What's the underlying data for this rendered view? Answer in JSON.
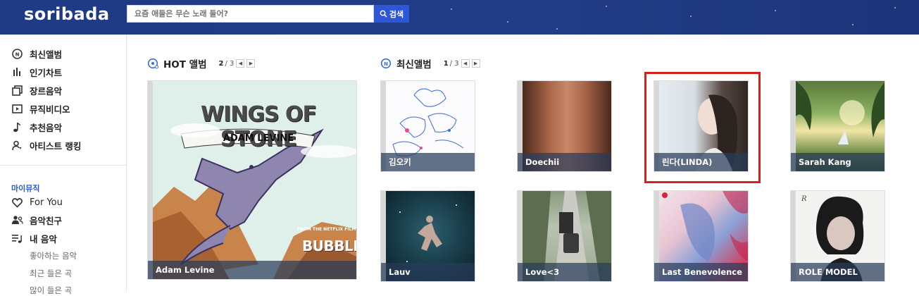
{
  "header": {
    "logo": "soribada",
    "search_placeholder": "요즘 애들은 무슨 노래 들어?",
    "search_button": "검색"
  },
  "sidebar": {
    "main_items": [
      {
        "label": "최신앨범",
        "icon": "new-album-icon"
      },
      {
        "label": "인기차트",
        "icon": "chart-bars-icon"
      },
      {
        "label": "장르음악",
        "icon": "genre-squares-icon"
      },
      {
        "label": "뮤직비디오",
        "icon": "video-play-icon"
      },
      {
        "label": "추천음악",
        "icon": "music-note-icon"
      },
      {
        "label": "아티스트 랭킹",
        "icon": "artist-person-icon"
      }
    ],
    "mymusic_label": "마이뮤직",
    "mymusic_items": [
      {
        "label": "For You",
        "icon": "heart-icon"
      },
      {
        "label": "음악친구",
        "icon": "friends-icon"
      },
      {
        "label": "내 음악",
        "icon": "my-music-list-icon"
      }
    ],
    "sub_items": [
      "좋아하는 음악",
      "최근 들은 곡",
      "많이 들은 곡"
    ]
  },
  "hot_album": {
    "title": "HOT 앨범",
    "page_current": "2",
    "page_total": "/ 3",
    "album": {
      "caption": "Adam Levine",
      "art_title": "WINGS OF STONE",
      "art_artist": "ADAM LEVINE",
      "art_netflix": "FROM THE NETFLIX FILM",
      "art_film": "BUBBLE"
    }
  },
  "new_album": {
    "title": "최신앨범",
    "page_current": "1",
    "page_total": "/ 3",
    "albums": [
      {
        "caption": "김오키"
      },
      {
        "caption": "Doechii"
      },
      {
        "caption": "린다(LINDA)"
      },
      {
        "caption": "Sarah Kang"
      },
      {
        "caption": "Lauv"
      },
      {
        "caption": "Love<3"
      },
      {
        "caption": "Last Benevolence"
      },
      {
        "caption": "ROLE MODEL"
      }
    ]
  }
}
